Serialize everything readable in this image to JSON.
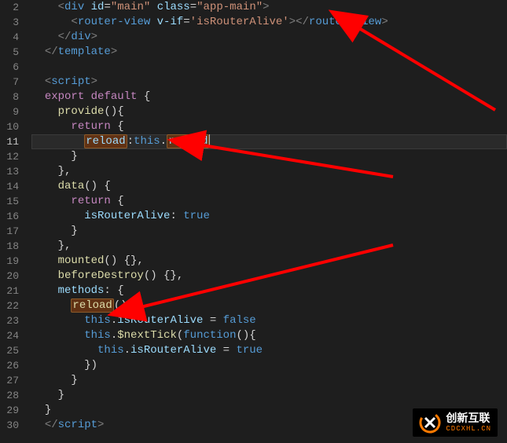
{
  "editor": {
    "active_line": 11,
    "lines": {
      "l2": {
        "indent": "    ",
        "open_tag": "div",
        "attr1": "id",
        "val1": "\"main\"",
        "attr2": "class",
        "val2": "\"app-main\""
      },
      "l3": {
        "indent": "      ",
        "open_tag": "router-view",
        "attr1": "v-if",
        "val1": "'isRouterAlive'",
        "close_tag": "router-view"
      },
      "l4": {
        "indent": "    ",
        "close_tag": "div"
      },
      "l5": {
        "indent": "  ",
        "close_tag": "template"
      },
      "l6": {
        "indent": ""
      },
      "l7": {
        "indent": "  ",
        "open_tag": "script"
      },
      "l8": {
        "indent": "  ",
        "kw1": "export",
        "kw2": "default",
        "brace": " {"
      },
      "l9": {
        "indent": "    ",
        "fn": "provide",
        "paren": "(){"
      },
      "l10": {
        "indent": "      ",
        "kw": "return",
        "brace": " {"
      },
      "l11": {
        "indent": "        ",
        "prop": "reload",
        "colon": ":",
        "this": "this",
        "dot": ".",
        "ref": "reload"
      },
      "l12": {
        "indent": "      ",
        "close": "}"
      },
      "l13": {
        "indent": "    ",
        "close": "},"
      },
      "l14": {
        "indent": "    ",
        "fn": "data",
        "paren": "() {"
      },
      "l15": {
        "indent": "      ",
        "kw": "return",
        "brace": " {"
      },
      "l16": {
        "indent": "        ",
        "prop": "isRouterAlive",
        "colon": ": ",
        "val": "true"
      },
      "l17": {
        "indent": "      ",
        "close": "}"
      },
      "l18": {
        "indent": "    ",
        "close": "},"
      },
      "l19": {
        "indent": "    ",
        "fn": "mounted",
        "paren": "() {},"
      },
      "l20": {
        "indent": "    ",
        "fn": "beforeDestroy",
        "paren": "() {},"
      },
      "l21": {
        "indent": "    ",
        "prop": "methods",
        "colon": ": {",
        "val": ""
      },
      "l22": {
        "indent": "      ",
        "fn": "reload",
        "paren": "(){"
      },
      "l23": {
        "indent": "        ",
        "this": "this",
        "dot": ".",
        "prop": "isRouterAlive",
        "eq": " = ",
        "val": "false"
      },
      "l24": {
        "indent": "        ",
        "this": "this",
        "dot": ".",
        "fn": "$nextTick",
        "open": "(",
        "kw": "function",
        "paren2": "(){"
      },
      "l25": {
        "indent": "          ",
        "this": "this",
        "dot": ".",
        "prop": "isRouterAlive",
        "eq": " = ",
        "val": "true"
      },
      "l26": {
        "indent": "        ",
        "close": "})"
      },
      "l27": {
        "indent": "      ",
        "close": "}"
      },
      "l28": {
        "indent": "    ",
        "close": "}"
      },
      "l29": {
        "indent": "  ",
        "close": "}"
      },
      "l30": {
        "indent": "  ",
        "close_tag": "script"
      }
    }
  },
  "annotations": {
    "arrow_color": "#ff0000"
  },
  "logo": {
    "text": "创新互联",
    "sub": "CDCXHL.CN",
    "accent": "#ff7a00"
  }
}
